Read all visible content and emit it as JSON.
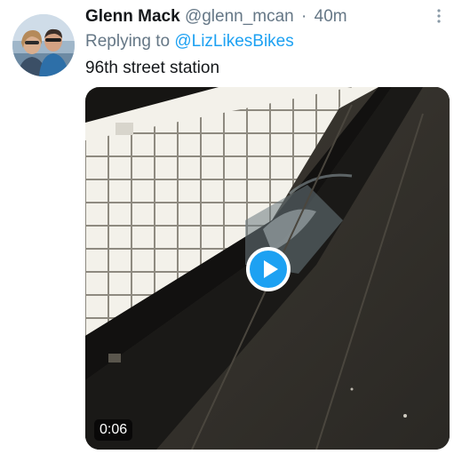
{
  "tweet": {
    "author_name": "Glenn Mack",
    "handle": "@glenn_mcan",
    "separator": "·",
    "timestamp": "40m",
    "reply_prefix": "Replying to",
    "reply_to": "@LizLikesBikes",
    "text": "96th street station",
    "more_icon": "more-vertical-icon",
    "avatar_icon": "profile-photo"
  },
  "media": {
    "type": "video",
    "duration": "0:06",
    "play_icon": "play-icon"
  },
  "colors": {
    "accent": "#1da1f2",
    "text_primary": "#14171a",
    "text_secondary": "#657786",
    "background": "#ffffff"
  }
}
